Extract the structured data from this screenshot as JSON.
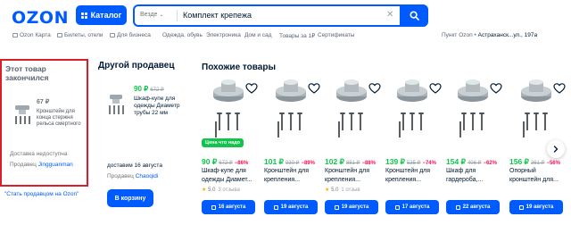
{
  "header": {
    "logo": "OZON",
    "catalog_label": "Каталог",
    "search_scope": "Везде",
    "search_query": "Комплект крепежа"
  },
  "subnav": {
    "items": [
      "Ozon Карта",
      "Билеты, отели",
      "Для бизнеса",
      "Одежда, обувь",
      "Электроника",
      "Дом и сад",
      "Товары за 1₽",
      "Сертификаты"
    ],
    "pickup_label": "Пункт Ozon",
    "pickup_address": "Астраханск...ул., 197а"
  },
  "out_of_stock": {
    "title_line1": "Этот товар",
    "title_line2": "закончился",
    "price": "67 ₽",
    "name": "Кронштейн для конца стержня рельса смертного",
    "shipping": "Доставка недоступна",
    "seller_label": "Продавец",
    "seller_name": "Jingguanman",
    "seller_link": "\"Стать продавцом на Ozon\""
  },
  "other_seller": {
    "heading": "Другой продавец",
    "price": "90 ₽",
    "old_price": "672 ₽",
    "name": "Шкаф-купе для одежды Диаметр трубы 22 мм",
    "delivery": "доставим 16 августа",
    "seller_label": "Продавец",
    "seller_name": "Chaoqidi",
    "cart_button": "В корзину"
  },
  "similar": {
    "heading": "Похожие товары",
    "products": [
      {
        "badge": "Цена что надо",
        "price": "90 ₽",
        "old_price": "672 ₽",
        "discount": "−86%",
        "name": "Шкаф-купе для одежды Диамет...",
        "rating": "5.0",
        "reviews": "3 отзыва",
        "date": "16 августа"
      },
      {
        "badge": "",
        "price": "101 ₽",
        "old_price": "930 ₽",
        "discount": "−89%",
        "name": "Кронштейн для крепления...",
        "rating": "",
        "reviews": "",
        "date": "19 августа"
      },
      {
        "badge": "",
        "price": "102 ₽",
        "old_price": "881 ₽",
        "discount": "−88%",
        "name": "Кронштейн для крепления...",
        "rating": "5.0",
        "reviews": "1 отзыв",
        "date": "19 августа"
      },
      {
        "badge": "",
        "price": "139 ₽",
        "old_price": "535 ₽",
        "discount": "−74%",
        "name": "Кронштейн для крепления...",
        "rating": "",
        "reviews": "",
        "date": "17 августа"
      },
      {
        "badge": "",
        "price": "154 ₽",
        "old_price": "406 ₽",
        "discount": "−62%",
        "name": "Шкаф для гардероба,...",
        "rating": "",
        "reviews": "",
        "date": "22 августа"
      },
      {
        "badge": "",
        "price": "156 ₽",
        "old_price": "361 ₽",
        "discount": "−56%",
        "name": "Опорный кронштейн для...",
        "rating": "",
        "reviews": "",
        "date": "19 августа"
      }
    ]
  },
  "colors": {
    "brand": "#005bff",
    "price_green": "#10c44c",
    "discount_red": "#f91155",
    "highlight_border": "#d9202a"
  }
}
